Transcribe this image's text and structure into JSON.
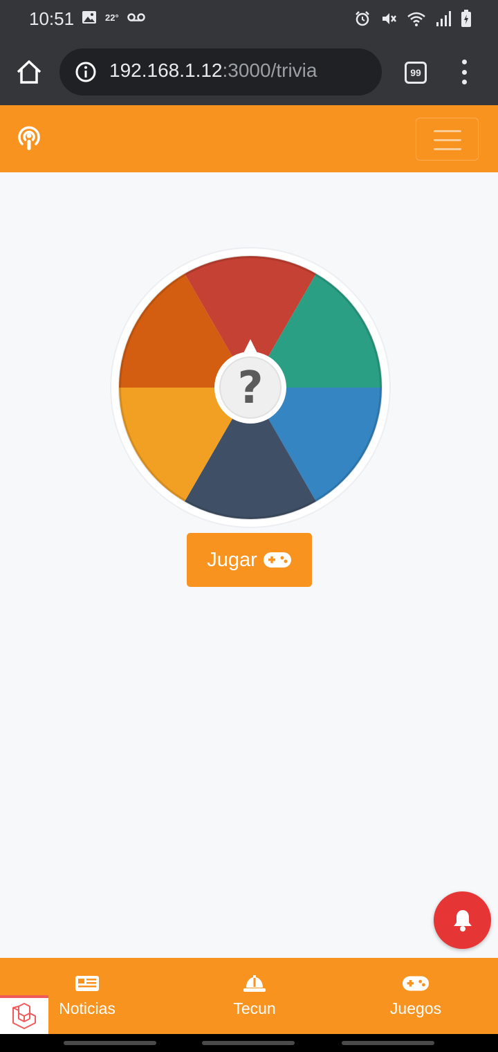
{
  "status_bar": {
    "time": "10:51",
    "temperature": "22°",
    "left_icons": [
      "image-icon",
      "voicemail-icon"
    ],
    "right_icons": [
      "alarm-icon",
      "mute-icon",
      "wifi-icon",
      "signal-icon",
      "battery-icon"
    ]
  },
  "browser": {
    "url_host": "192.168.1.12",
    "url_path": ":3000/trivia",
    "tab_count": "99",
    "icons": [
      "home-icon",
      "info-icon",
      "more-vert-icon"
    ]
  },
  "navbar": {
    "brand_icon": "podcast-icon",
    "toggler_icon": "hamburger-icon",
    "color": "#f7931e"
  },
  "wheel": {
    "center_symbol": "?",
    "segment_colors": [
      "#c44133",
      "#2a9f84",
      "#3485c1",
      "#3f5066",
      "#f2a024",
      "#d35e11"
    ]
  },
  "play_button": {
    "label": "Jugar",
    "icon": "gamepad-icon"
  },
  "notification_button": {
    "icon": "bell-icon",
    "color": "#e53535"
  },
  "bottom_nav": {
    "items": [
      {
        "label": "Noticias",
        "icon": "newspaper-icon"
      },
      {
        "label": "Tecun",
        "icon": "hard-hat-icon"
      },
      {
        "label": "Juegos",
        "icon": "gamepad-icon"
      }
    ],
    "badge_icon": "laravel-icon"
  }
}
